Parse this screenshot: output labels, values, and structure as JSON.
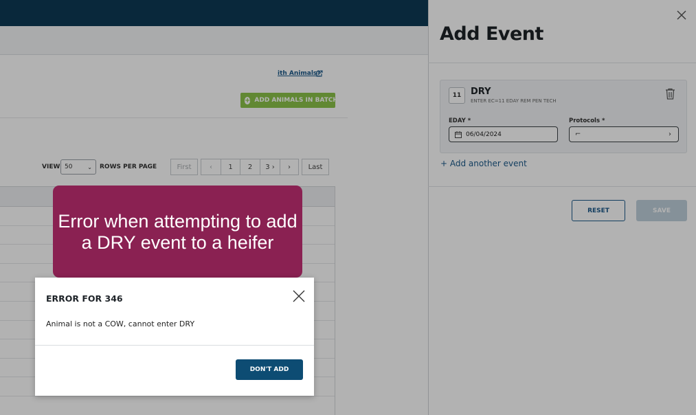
{
  "background_page": {
    "animals_link": "ith Animals?",
    "batch_button": "ADD ANIMALS IN BATCH",
    "view_label": "VIEW",
    "rows_select_value": "50",
    "rows_label": "ROWS PER PAGE",
    "pager": [
      "First",
      "‹",
      "1",
      "2",
      "3 ›",
      "›",
      "Last"
    ]
  },
  "panel": {
    "title": "Add Event",
    "event": {
      "number": "11",
      "name": "DRY",
      "hint": "ENTER EC=11 EDAY REM PEN TECH",
      "eday_label": "EDAY *",
      "eday_value": "06/04/2024",
      "protocols_label": "Protocols *",
      "protocols_value": "⌐"
    },
    "add_another": "+ Add another event",
    "reset_label": "RESET",
    "save_label": "SAVE"
  },
  "callout": {
    "text": "Error when attempting to add a DRY event to a heifer"
  },
  "dialog": {
    "title": "ERROR FOR 346",
    "message": "Animal is not a COW, cannot enter DRY",
    "button": "DON'T ADD"
  },
  "colors": {
    "topbar": "#0d3a55",
    "callout": "#8a2152",
    "primary_button": "#0d4c73",
    "batch_button": "#8bc34a",
    "link": "#1c5a8a"
  }
}
